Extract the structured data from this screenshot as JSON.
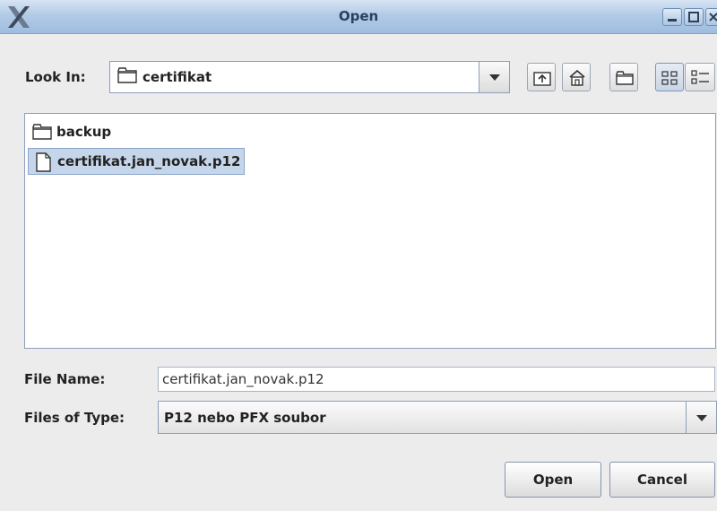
{
  "window": {
    "title": "Open",
    "app_icon": "x-logo-icon",
    "controls": [
      "minimize-icon",
      "maximize-icon",
      "close-icon"
    ]
  },
  "look_in": {
    "label": "Look In:",
    "mnemonic": "I",
    "value": "certifikat",
    "folder_icon": "folder-icon"
  },
  "toolbar": {
    "buttons": [
      "up-folder-icon",
      "home-icon",
      "new-folder-icon",
      "list-view-icon",
      "details-view-icon"
    ]
  },
  "files": [
    {
      "name": "backup",
      "icon": "folder-icon",
      "selected": false
    },
    {
      "name": "certifikat.jan_novak.p12",
      "icon": "file-icon",
      "selected": true
    }
  ],
  "file_name": {
    "label": "File Name:",
    "mnemonic": "N",
    "value": "certifikat.jan_novak.p12"
  },
  "file_type": {
    "label": "Files of Type:",
    "mnemonic": "T",
    "value": "P12 nebo PFX soubor"
  },
  "actions": {
    "open_label": "Open",
    "cancel_label": "Cancel"
  },
  "colors": {
    "titlebar": "#b2cbe6",
    "selection": "#c6d6ea",
    "background": "#ececec"
  }
}
